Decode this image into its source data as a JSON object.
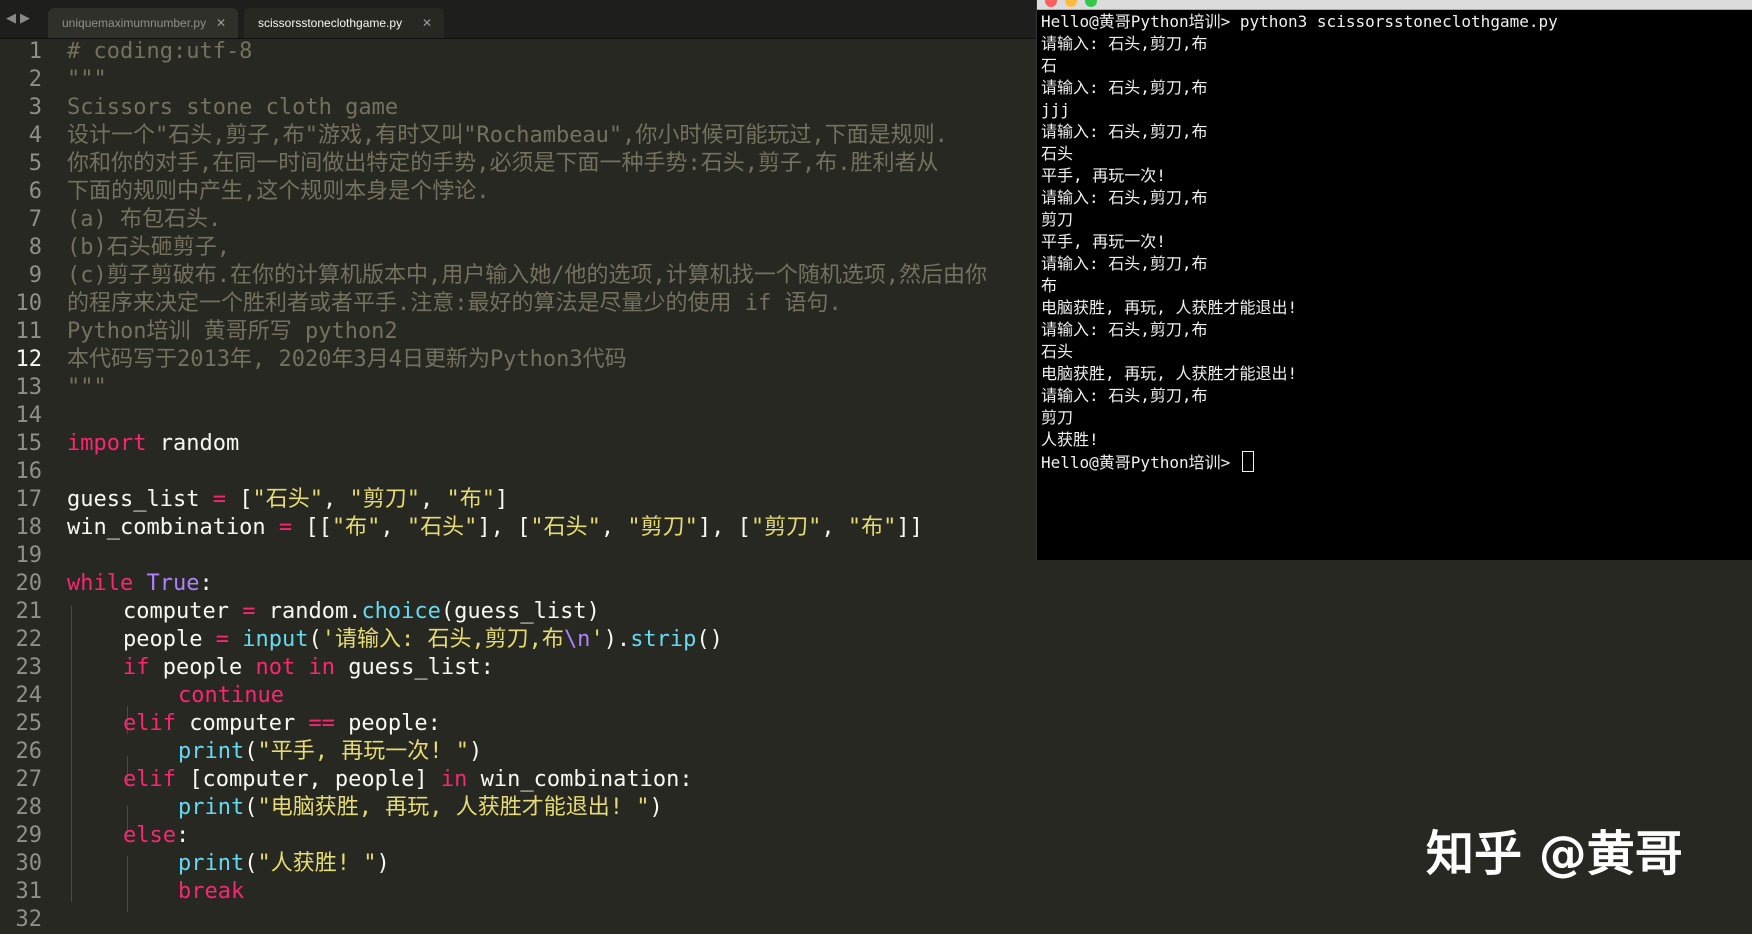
{
  "tabs": [
    {
      "label": "uniquemaximumnumber.py",
      "active": false
    },
    {
      "label": "scissorsstoneclothgame.py",
      "active": true
    }
  ],
  "editor": {
    "current_line": 12,
    "line_numbers": [
      "1",
      "2",
      "3",
      "4",
      "5",
      "6",
      "7",
      "8",
      "9",
      "10",
      "11",
      "12",
      "13",
      "14",
      "15",
      "16",
      "17",
      "18",
      "19",
      "20",
      "21",
      "22",
      "23",
      "24",
      "25",
      "26",
      "27",
      "28",
      "29",
      "30",
      "31",
      "32"
    ],
    "code": {
      "l1": "# coding:utf-8",
      "l2": "\"\"\"",
      "l3": "Scissors stone cloth game",
      "l4": "设计一个\"石头,剪子,布\"游戏,有时又叫\"Rochambeau\",你小时候可能玩过,下面是规则.",
      "l5": "你和你的对手,在同一时间做出特定的手势,必须是下面一种手势:石头,剪子,布.胜利者从",
      "l6": "下面的规则中产生,这个规则本身是个悖论.",
      "l7": "(a) 布包石头.",
      "l8": "(b)石头砸剪子,",
      "l9": "(c)剪子剪破布.在你的计算机版本中,用户输入她/他的选项,计算机找一个随机选项,然后由你",
      "l10": "的程序来决定一个胜利者或者平手.注意:最好的算法是尽量少的使用 if 语句.",
      "l11": "Python培训 黄哥所写 python2",
      "l12": "本代码写于2013年, 2020年3月4日更新为Python3代码",
      "l13": "\"\"\"",
      "l15_kw": "import",
      "l15_mod": " random",
      "l17_var": "guess_list ",
      "l17_eq": "=",
      "l17_b1": " [",
      "l17_s1": "\"石头\"",
      "l17_c1": ", ",
      "l17_s2": "\"剪刀\"",
      "l17_c2": ", ",
      "l17_s3": "\"布\"",
      "l17_b2": "]",
      "l18_var": "win_combination ",
      "l18_eq": "=",
      "l18_b1": " [[",
      "l18_s1": "\"布\"",
      "l18_c1": ", ",
      "l18_s2": "\"石头\"",
      "l18_c2": "], [",
      "l18_s3": "\"石头\"",
      "l18_c3": ", ",
      "l18_s4": "\"剪刀\"",
      "l18_c4": "], [",
      "l18_s5": "\"剪刀\"",
      "l18_c5": ", ",
      "l18_s6": "\"布\"",
      "l18_b2": "]]",
      "l20_kw": "while",
      "l20_sp": " ",
      "l20_true": "True",
      "l20_colon": ":",
      "l21_var": "computer ",
      "l21_eq": "=",
      "l21_mod": " random.",
      "l21_fn": "choice",
      "l21_args": "(guess_list)",
      "l22_var": "people ",
      "l22_eq": "=",
      "l22_sp": " ",
      "l22_fn": "input",
      "l22_p1": "(",
      "l22_str": "'请输入: 石头,剪刀,布",
      "l22_esc": "\\n",
      "l22_str2": "'",
      "l22_p2": ").",
      "l22_fn2": "strip",
      "l22_p3": "()",
      "l23_kw": "if",
      "l23_var": " people ",
      "l23_op": "not in",
      "l23_rest": " guess_list:",
      "l24_kw": "continue",
      "l25_kw": "elif",
      "l25_var": " computer ",
      "l25_op": "==",
      "l25_rest": " people:",
      "l26_fn": "print",
      "l26_p1": "(",
      "l26_str": "\"平手, 再玩一次! \"",
      "l26_p2": ")",
      "l27_kw": "elif",
      "l27_var": " [computer, people] ",
      "l27_op": "in",
      "l27_rest": " win_combination:",
      "l28_fn": "print",
      "l28_p1": "(",
      "l28_str": "\"电脑获胜, 再玩, 人获胜才能退出! \"",
      "l28_p2": ")",
      "l29_kw": "else",
      "l29_colon": ":",
      "l30_fn": "print",
      "l30_p1": "(",
      "l30_str": "\"人获胜! \"",
      "l30_p2": ")",
      "l31_kw": "break"
    }
  },
  "terminal": {
    "lines": [
      "Hello@黄哥Python培训> python3 scissorsstoneclothgame.py",
      "请输入: 石头,剪刀,布",
      "石",
      "请输入: 石头,剪刀,布",
      "jjj",
      "请输入: 石头,剪刀,布",
      "石头",
      "平手, 再玩一次!",
      "请输入: 石头,剪刀,布",
      "剪刀",
      "平手, 再玩一次!",
      "请输入: 石头,剪刀,布",
      "布",
      "电脑获胜, 再玩, 人获胜才能退出!",
      "请输入: 石头,剪刀,布",
      "石头",
      "电脑获胜, 再玩, 人获胜才能退出!",
      "请输入: 石头,剪刀,布",
      "剪刀",
      "人获胜!",
      "Hello@黄哥Python培训> "
    ]
  },
  "watermark": "知乎 @黄哥",
  "colors": {
    "editor_bg": "#272822",
    "keyword": "#f92672",
    "string": "#e6db74",
    "function": "#66d9ef",
    "constant": "#ae81ff",
    "comment": "#75715e",
    "terminal_bg": "#000000"
  }
}
